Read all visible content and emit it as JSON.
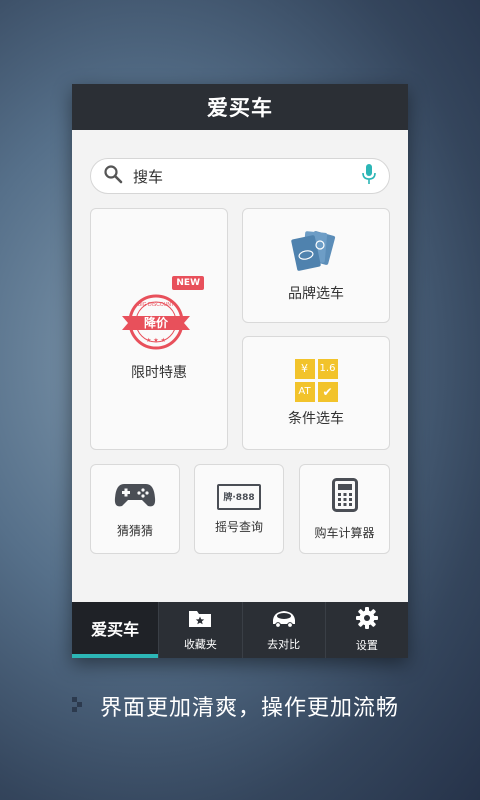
{
  "app": {
    "title": "爱买车"
  },
  "search": {
    "placeholder": "搜车"
  },
  "cards": {
    "limited_offer": {
      "label": "限时特惠",
      "badge": "NEW",
      "stamp_text": "降价",
      "stamp_ring": "BIG DISCOUNT"
    },
    "brand_select": {
      "label": "品牌选车"
    },
    "condition_select": {
      "label": "条件选车",
      "tiles": [
        "¥",
        "1.6",
        "AT",
        "✔"
      ]
    }
  },
  "tools": [
    {
      "label": "猜猜猜",
      "icon": "gamepad-icon"
    },
    {
      "label": "摇号查询",
      "icon": "license-plate-icon",
      "plate_text": "牌·888"
    },
    {
      "label": "购车计算器",
      "icon": "calculator-icon"
    }
  ],
  "tabbar": {
    "tabs": [
      {
        "label": "爱买车",
        "active": true
      },
      {
        "label": "收藏夹",
        "icon": "folder-star-icon"
      },
      {
        "label": "去对比",
        "icon": "car-compare-icon"
      },
      {
        "label": "设置",
        "icon": "gear-icon"
      }
    ]
  },
  "caption": "界面更加清爽，操作更加流畅",
  "colors": {
    "accent": "#2cb6b6",
    "titlebar": "#2b2f35",
    "stamp": "#e8505b",
    "brand_icon": "#5b8db8",
    "condition_icon": "#f2c32b"
  }
}
